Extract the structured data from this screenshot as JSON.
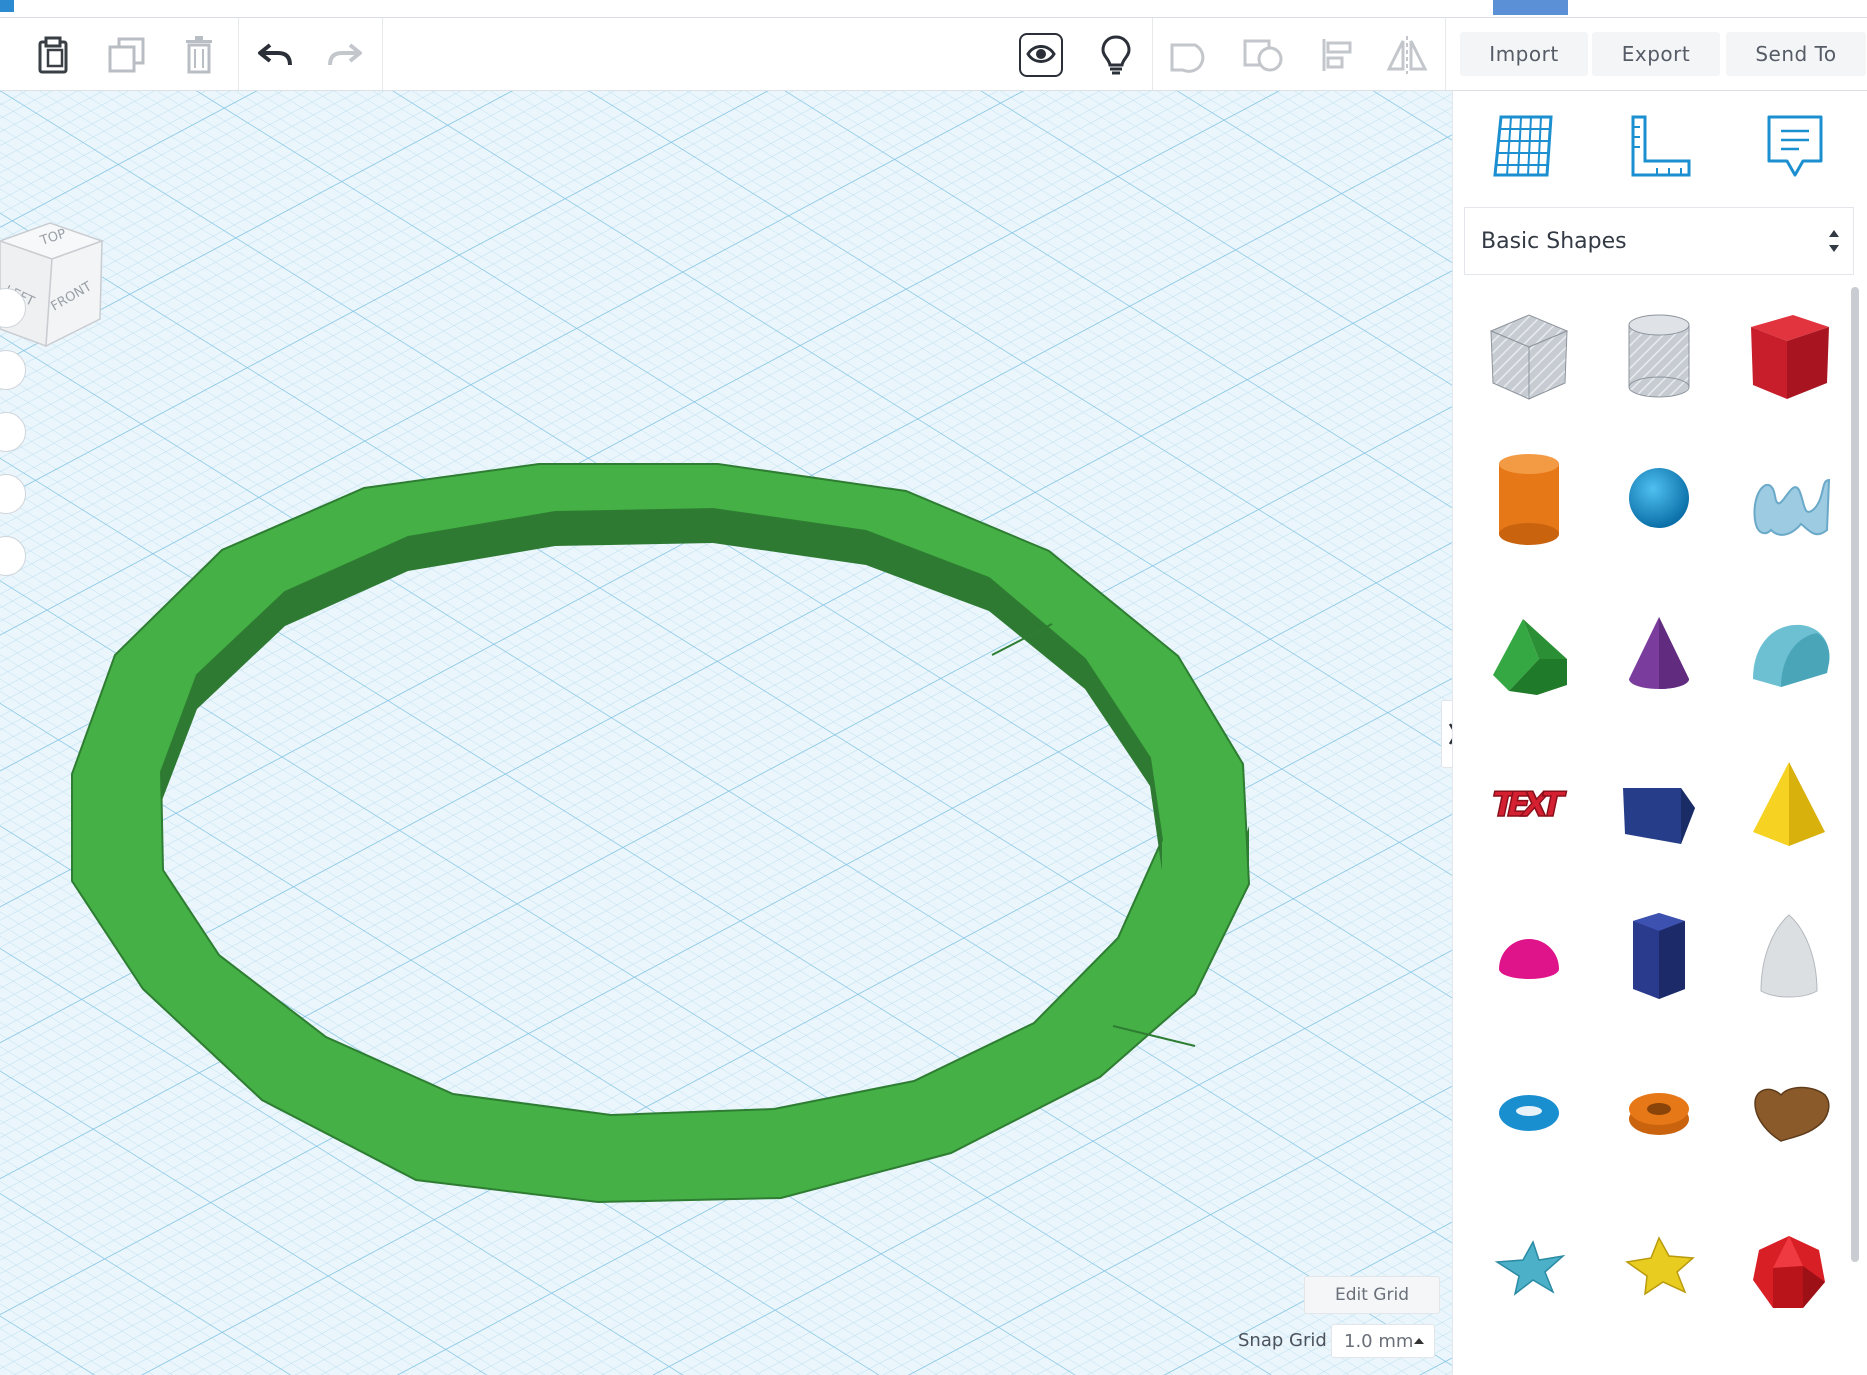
{
  "toolbar": {
    "import_label": "Import",
    "export_label": "Export",
    "send_to_label": "Send To"
  },
  "viewcube": {
    "top_label": "TOP",
    "left_label": "LEFT",
    "front_label": "FRONT"
  },
  "sidebar": {
    "category": "Basic Shapes",
    "shapes": [
      {
        "name": "box-hole",
        "color": "#b9c0c9"
      },
      {
        "name": "cylinder-hole",
        "color": "#c5cbd2"
      },
      {
        "name": "box",
        "color": "#d1222f"
      },
      {
        "name": "cylinder",
        "color": "#e77817"
      },
      {
        "name": "sphere",
        "color": "#1a8fd0"
      },
      {
        "name": "scribble",
        "color": "#8fc2dc"
      },
      {
        "name": "roof",
        "color": "#2f9a3a"
      },
      {
        "name": "cone",
        "color": "#7b3d9d"
      },
      {
        "name": "round-roof",
        "color": "#5fb7c9"
      },
      {
        "name": "text",
        "color": "#cc1f2e"
      },
      {
        "name": "wedge",
        "color": "#24387e"
      },
      {
        "name": "pyramid",
        "color": "#f0cc1a"
      },
      {
        "name": "half-sphere",
        "color": "#e0148a"
      },
      {
        "name": "polygon",
        "color": "#2a3a8c"
      },
      {
        "name": "paraboloid",
        "color": "#dcdfe2"
      },
      {
        "name": "torus",
        "color": "#1a8fd0"
      },
      {
        "name": "tube",
        "color": "#e77817"
      },
      {
        "name": "heart",
        "color": "#8b5a2b"
      },
      {
        "name": "star",
        "color": "#4bb0c8"
      },
      {
        "name": "star-six",
        "color": "#e8cc20"
      },
      {
        "name": "icosahedron",
        "color": "#d81f26"
      }
    ]
  },
  "canvas": {
    "edit_grid_label": "Edit Grid",
    "snap_grid_label": "Snap Grid",
    "snap_value": "1.0 mm",
    "ring_color": "#44b044"
  }
}
